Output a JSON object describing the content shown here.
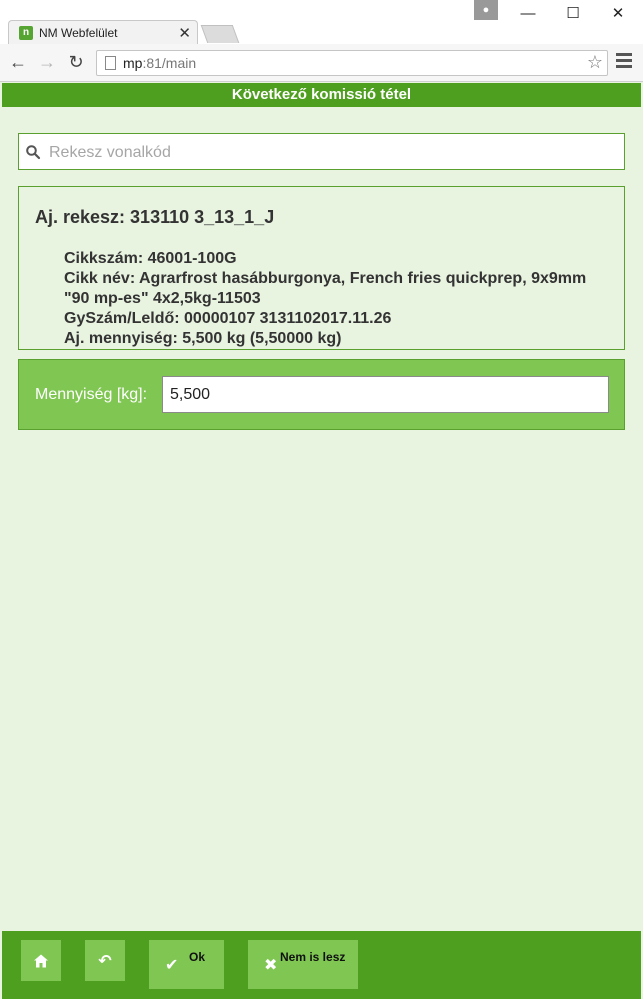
{
  "browser": {
    "tab_title": "NM Webfelület",
    "tab_favicon_text": "n",
    "url_host": "mp",
    "url_rest": ":81/main"
  },
  "app": {
    "header_title": "Következő komissió tétel",
    "search": {
      "placeholder": "Rekesz vonalkód",
      "value": ""
    },
    "info": {
      "title": "Aj. rekesz: 313110 3_13_1_J",
      "lines": [
        "Cikkszám: 46001-100G",
        "Cikk név: Agrarfrost hasábburgonya, French fries quickprep, 9x9mm",
        "\"90 mp-es\" 4x2,5kg-11503",
        "GySzám/Leldő: 00000107 3131102017.11.26",
        "Aj. mennyiség: 5,500 kg (5,50000 kg)"
      ]
    },
    "quantity": {
      "label": "Mennyiség [kg]:",
      "value": "5,500"
    },
    "footer": {
      "ok_label": "Ok",
      "cancel_label": "Nem is lesz"
    }
  },
  "colors": {
    "header_green": "#4e9f1f",
    "light_green": "#80c653",
    "page_background": "#e8f3e0"
  },
  "icons": [
    "home-icon",
    "undo-icon",
    "check-icon",
    "x-icon",
    "search-icon",
    "star-icon",
    "menu-icon"
  ]
}
